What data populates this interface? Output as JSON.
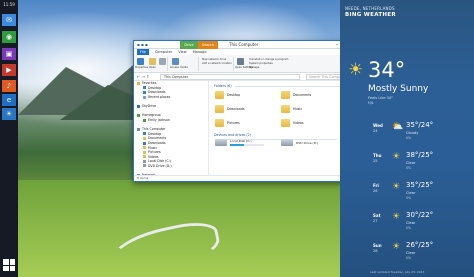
{
  "rail": {
    "clock": "11:59",
    "apps": [
      "chat-icon",
      "xbox-icon",
      "photos-icon",
      "video-icon",
      "music-icon",
      "ie-icon",
      "weather-icon"
    ],
    "start_icon": "windows-logo-icon"
  },
  "explorer": {
    "contextual_tab_1": "Drive Tools",
    "contextual_tab_2": "Search Tools",
    "title": "This Computer",
    "ribbon_tabs": [
      "File",
      "Computer",
      "View",
      "Manage"
    ],
    "ribbon": {
      "properties": "Properties",
      "open": "Open",
      "rename": "Rename",
      "access_media": "Access media",
      "map_network": "Map network drive",
      "add_network": "Add a network location",
      "open_settings": "Open Settings",
      "uninstall": "Uninstall or change a program",
      "system_properties": "System properties",
      "manage": "Manage"
    },
    "address": "This Computer",
    "search_placeholder": "Search This Computer",
    "nav": [
      {
        "label": "Favorites",
        "color": "#e8b73a"
      },
      {
        "label": "Desktop",
        "color": "#3b7fc7"
      },
      {
        "label": "Downloads",
        "color": "#3b7fc7"
      },
      {
        "label": "Recent places",
        "color": "#7aa3c9"
      },
      {
        "label": "",
        "color": ""
      },
      {
        "label": "SkyDrive",
        "color": "#2f6fbf"
      },
      {
        "label": "",
        "color": ""
      },
      {
        "label": "Homegroup",
        "color": "#4f9b3e"
      },
      {
        "label": "Emily Jackson",
        "color": "#4f9b3e"
      },
      {
        "label": "",
        "color": ""
      },
      {
        "label": "This Computer",
        "color": "#6b8fb5"
      },
      {
        "label": "Desktop",
        "color": "#3b7fc7"
      },
      {
        "label": "Documents",
        "color": "#e2bf5a"
      },
      {
        "label": "Downloads",
        "color": "#3b7fc7"
      },
      {
        "label": "Music",
        "color": "#e2bf5a"
      },
      {
        "label": "Pictures",
        "color": "#e2bf5a"
      },
      {
        "label": "Videos",
        "color": "#e2bf5a"
      },
      {
        "label": "Local Disk (C:)",
        "color": "#8e9aa8"
      },
      {
        "label": "DVD Drive (D:)",
        "color": "#8e9aa8"
      },
      {
        "label": "",
        "color": ""
      },
      {
        "label": "Network",
        "color": "#6b8fb5"
      },
      {
        "label": "DC",
        "color": "#6b8fb5"
      }
    ],
    "folders_header": "Folders (6)",
    "folders": [
      "Desktop",
      "Documents",
      "Downloads",
      "Music",
      "Pictures",
      "Videos"
    ],
    "drives_header": "Devices and drives (2)",
    "drives": [
      {
        "name": "Local Disk (C:)",
        "free": "",
        "fill": 0.42
      },
      {
        "name": "DVD Drive (D:)",
        "free": "",
        "fill": 0.0
      }
    ],
    "status": "8 items"
  },
  "weather": {
    "location": "NEEDE, NETHERLANDS",
    "app_name": "BING WEATHER",
    "temp": "34°",
    "condition": "Mostly Sunny",
    "feels": "Feels Like 34°",
    "extra": "H/L",
    "forecast": [
      {
        "day": "Wed",
        "date": "24",
        "temps": "35°/24°",
        "cond": "Cloudy",
        "pct": "0%",
        "icon": "partly-cloudy-icon"
      },
      {
        "day": "Thu",
        "date": "25",
        "temps": "38°/25°",
        "cond": "Clear",
        "pct": "0%",
        "icon": "sun-icon"
      },
      {
        "day": "Fri",
        "date": "26",
        "temps": "35°/25°",
        "cond": "Clear",
        "pct": "0%",
        "icon": "sun-icon"
      },
      {
        "day": "Sat",
        "date": "27",
        "temps": "30°/22°",
        "cond": "Clear",
        "pct": "0%",
        "icon": "sun-icon"
      },
      {
        "day": "Sun",
        "date": "28",
        "temps": "26°/25°",
        "cond": "Clear",
        "pct": "0%",
        "icon": "sun-icon"
      }
    ],
    "footer": "Last updated Tuesday, July 23, 2013"
  }
}
